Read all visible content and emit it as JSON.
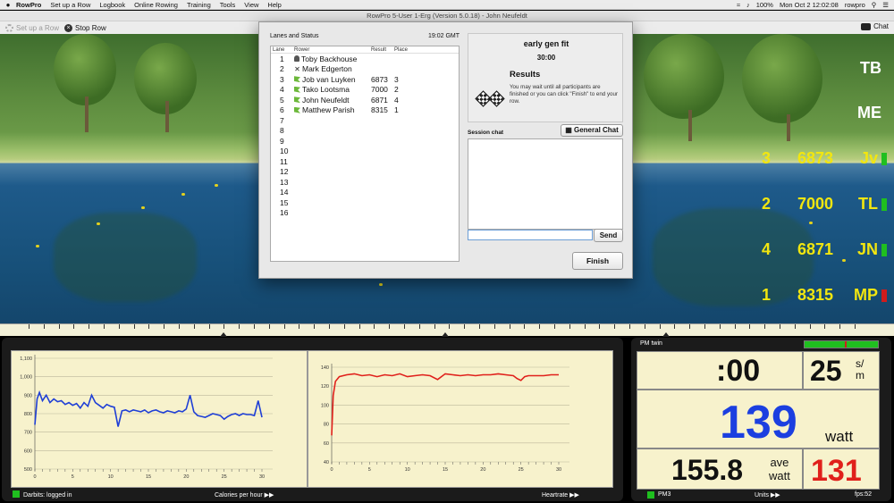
{
  "menubar": {
    "apple_icon": "apple-icon",
    "app_name": "RowPro",
    "items": [
      "Set up a Row",
      "Logbook",
      "Online Rowing",
      "Training",
      "Tools",
      "View",
      "Help"
    ],
    "clock": "Mon Oct 2  12:02:08",
    "user": "rowpro",
    "battery": "100%"
  },
  "window_title": "RowPro 5-User 1-Erg (Version 5.0.18) - John Neufeldt",
  "toolbar": {
    "setup_label": "Set up a Row",
    "stop_label": "Stop Row",
    "chat_label": "Chat"
  },
  "scoreboard": {
    "initials_top": [
      "TB",
      "ME"
    ],
    "rows": [
      {
        "place": "3",
        "result": "6873",
        "abbr": "Jv",
        "bar_color": "#1fbf1f"
      },
      {
        "place": "2",
        "result": "7000",
        "abbr": "TL",
        "bar_color": "#1fbf1f"
      },
      {
        "place": "4",
        "result": "6871",
        "abbr": "JN",
        "bar_color": "#1fbf1f"
      },
      {
        "place": "1",
        "result": "8315",
        "abbr": "MP",
        "bar_color": "#d01c1c"
      }
    ]
  },
  "modal": {
    "lanes_title": "Lanes and Status",
    "time": "19:02 GMT",
    "columns": {
      "lane": "Lane",
      "rower": "Rower",
      "result": "Result",
      "place": "Place"
    },
    "lanes": [
      {
        "lane": "1",
        "icon": "person-icon",
        "rower": "Toby Backhouse",
        "result": "",
        "place": ""
      },
      {
        "lane": "2",
        "icon": "x-icon",
        "rower": "Mark Edgerton",
        "result": "",
        "place": ""
      },
      {
        "lane": "3",
        "icon": "flag-icon",
        "rower": "Job van Luyken",
        "result": "6873",
        "place": "3"
      },
      {
        "lane": "4",
        "icon": "flag-icon",
        "rower": "Tako Lootsma",
        "result": "7000",
        "place": "2"
      },
      {
        "lane": "5",
        "icon": "flag-icon",
        "rower": "John Neufeldt",
        "result": "6871",
        "place": "4"
      },
      {
        "lane": "6",
        "icon": "flag-icon",
        "rower": "Matthew Parish",
        "result": "8315",
        "place": "1"
      },
      {
        "lane": "7",
        "icon": "",
        "rower": "",
        "result": "",
        "place": ""
      },
      {
        "lane": "8",
        "icon": "",
        "rower": "",
        "result": "",
        "place": ""
      },
      {
        "lane": "9",
        "icon": "",
        "rower": "",
        "result": "",
        "place": ""
      },
      {
        "lane": "10",
        "icon": "",
        "rower": "",
        "result": "",
        "place": ""
      },
      {
        "lane": "11",
        "icon": "",
        "rower": "",
        "result": "",
        "place": ""
      },
      {
        "lane": "12",
        "icon": "",
        "rower": "",
        "result": "",
        "place": ""
      },
      {
        "lane": "13",
        "icon": "",
        "rower": "",
        "result": "",
        "place": ""
      },
      {
        "lane": "14",
        "icon": "",
        "rower": "",
        "result": "",
        "place": ""
      },
      {
        "lane": "15",
        "icon": "",
        "rower": "",
        "result": "",
        "place": ""
      },
      {
        "lane": "16",
        "icon": "",
        "rower": "",
        "result": "",
        "place": ""
      }
    ],
    "session_name": "early gen fit",
    "duration": "30:00",
    "results_title": "Results",
    "results_text": "You may wait until all participants are finished or you can click \"Finish\" to end your row.",
    "session_chat_label": "Session chat",
    "general_chat_label": "General Chat",
    "chat_input_value": "",
    "send_label": "Send",
    "finish_label": "Finish"
  },
  "graphs": {
    "darbits_status": "Darbits: logged in",
    "left_label": "Calories per hour",
    "right_label": "Heartrate"
  },
  "chart_data": [
    {
      "type": "line",
      "title": "",
      "xlabel": "Calories per hour",
      "ylabel": "",
      "xlim": [
        0,
        30
      ],
      "ylim": [
        500,
        1100
      ],
      "x_ticks": [
        "0",
        "5",
        "10",
        "15",
        "20",
        "25",
        "30"
      ],
      "y_ticks": [
        "500",
        "600",
        "700",
        "800",
        "900",
        "1,000",
        "1,100"
      ],
      "grid": true,
      "series": [
        {
          "color": "#1f3fd6",
          "x": [
            0,
            0.3,
            0.6,
            1,
            1.5,
            2,
            2.5,
            3,
            3.5,
            4,
            4.5,
            5,
            5.5,
            6,
            6.5,
            7,
            7.5,
            8,
            8.5,
            9,
            9.5,
            10,
            10.5,
            11,
            11.5,
            12,
            12.5,
            13,
            13.5,
            14,
            14.5,
            15,
            15.5,
            16,
            16.5,
            17,
            17.5,
            18,
            18.5,
            19,
            19.5,
            20,
            20.5,
            21,
            21.5,
            22,
            22.5,
            23,
            23.5,
            24,
            24.5,
            25,
            25.5,
            26,
            26.5,
            27,
            27.5,
            28,
            28.5,
            29,
            29.5,
            30
          ],
          "y": [
            740,
            880,
            915,
            870,
            900,
            860,
            880,
            865,
            870,
            850,
            860,
            845,
            855,
            830,
            860,
            840,
            900,
            860,
            845,
            830,
            850,
            840,
            835,
            730,
            815,
            820,
            810,
            820,
            815,
            810,
            820,
            805,
            815,
            820,
            810,
            805,
            815,
            810,
            805,
            815,
            810,
            825,
            900,
            810,
            790,
            785,
            780,
            790,
            800,
            795,
            790,
            770,
            785,
            795,
            800,
            790,
            800,
            795,
            795,
            790,
            870,
            780
          ]
        }
      ]
    },
    {
      "type": "line",
      "title": "",
      "xlabel": "Heartrate",
      "ylabel": "",
      "xlim": [
        0,
        30
      ],
      "ylim": [
        40,
        140
      ],
      "x_ticks": [
        "0",
        "5",
        "10",
        "15",
        "20",
        "25",
        "30"
      ],
      "y_ticks": [
        "40",
        "60",
        "80",
        "100",
        "120",
        "140"
      ],
      "grid": true,
      "series": [
        {
          "color": "#e0201b",
          "x": [
            0,
            0.2,
            0.5,
            1,
            2,
            3,
            4,
            5,
            6,
            7,
            8,
            9,
            10,
            11,
            12,
            13,
            14,
            15,
            16,
            17,
            18,
            19,
            20,
            21,
            22,
            23,
            24,
            24.5,
            25,
            25.5,
            26,
            27,
            28,
            29,
            30
          ],
          "y": [
            68,
            110,
            125,
            130,
            132,
            133,
            131,
            132,
            130,
            132,
            131,
            133,
            130,
            131,
            132,
            131,
            127,
            133,
            132,
            131,
            132,
            131,
            132,
            132,
            133,
            132,
            131,
            128,
            126,
            130,
            131,
            131,
            131,
            132,
            132
          ]
        }
      ]
    }
  ],
  "monitor": {
    "title": "PM twin",
    "time_value": ":00",
    "spm_value": "25",
    "spm_unit": "s/\nm",
    "watts_value": "139",
    "watts_unit": "watt",
    "ave_value": "155.8",
    "ave_unit": "ave\nwatt",
    "hr_value": "131",
    "pm_label": "PM3",
    "units_label": "Units",
    "fps_label": "fps:52",
    "colors": {
      "watts": "#1b3fe0",
      "hr": "#e0201b",
      "status_green": "#1fbf1f"
    }
  }
}
